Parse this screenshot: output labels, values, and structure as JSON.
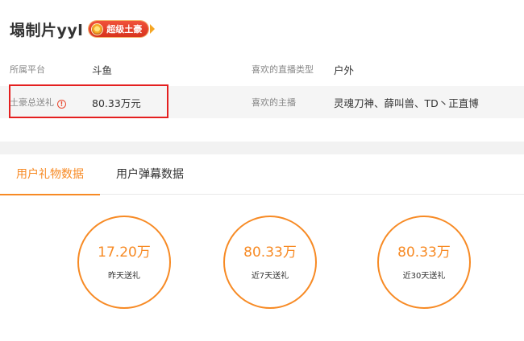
{
  "user": {
    "name": "塌制片yyl",
    "badge": "超级土豪"
  },
  "info": {
    "platform_label": "所属平台",
    "platform_value": "斗鱼",
    "fav_type_label": "喜欢的直播类型",
    "fav_type_value": "户外",
    "gift_total_label": "土豪总送礼",
    "gift_total_value": "80.33万元",
    "fav_anchor_label": "喜欢的主播",
    "fav_anchor_value": "灵魂刀神、薛叫兽、TD丶正直博"
  },
  "tabs": [
    {
      "label": "用户礼物数据",
      "active": true
    },
    {
      "label": "用户弹幕数据",
      "active": false
    }
  ],
  "stats": [
    {
      "value": "17.20万",
      "label": "昨天送礼"
    },
    {
      "value": "80.33万",
      "label": "近7天送礼"
    },
    {
      "value": "80.33万",
      "label": "近30天送礼"
    }
  ],
  "colors": {
    "accent": "#f78a24",
    "highlight_box": "#e41f1f"
  }
}
